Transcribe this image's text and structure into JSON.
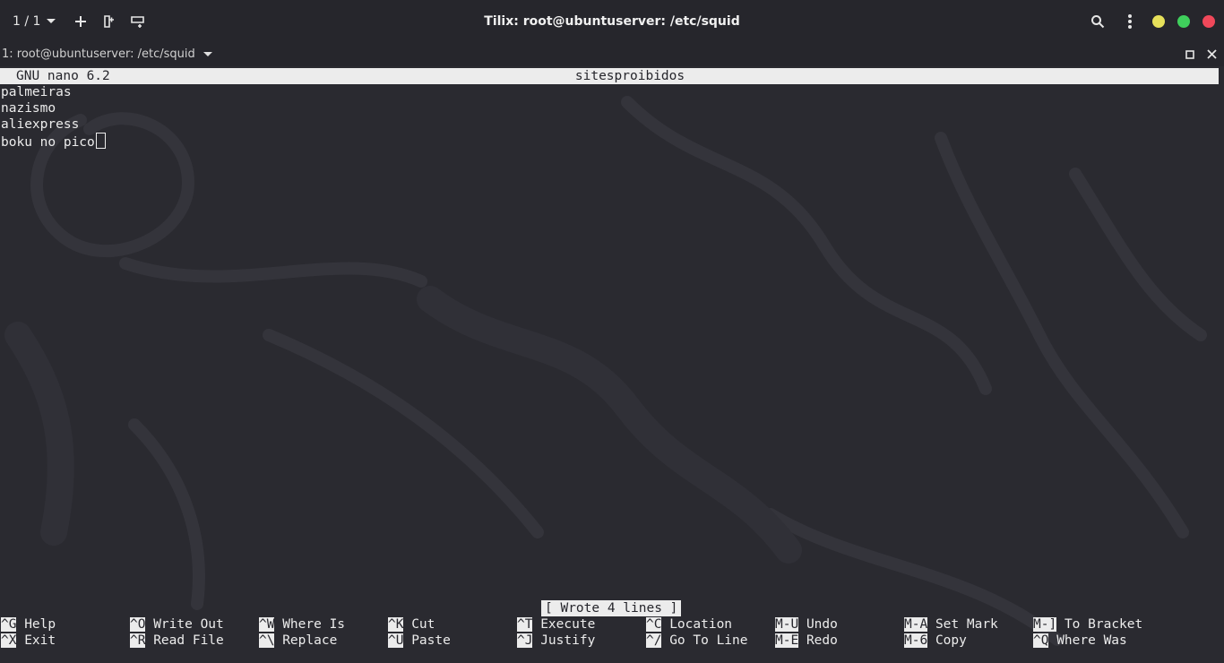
{
  "header": {
    "session_count": "1 / 1",
    "title": "Tilix: root@ubuntuserver: /etc/squid",
    "colors": {
      "minimize": "#e6e05a",
      "maximize": "#3fcf5c",
      "close": "#f0485a"
    }
  },
  "terminal_tab": {
    "title": "1: root@ubuntuserver: /etc/squid"
  },
  "nano": {
    "version": "GNU nano 6.2",
    "filename": "sitesproibidos",
    "lines": [
      "palmeiras",
      "nazismo",
      "aliexpress",
      "boku no pico"
    ],
    "status": "[ Wrote 4 lines ]",
    "shortcuts_row1": [
      {
        "key": "^G",
        "label": "Help"
      },
      {
        "key": "^O",
        "label": "Write Out"
      },
      {
        "key": "^W",
        "label": "Where Is"
      },
      {
        "key": "^K",
        "label": "Cut"
      },
      {
        "key": "^T",
        "label": "Execute"
      },
      {
        "key": "^C",
        "label": "Location"
      },
      {
        "key": "M-U",
        "label": "Undo"
      },
      {
        "key": "M-A",
        "label": "Set Mark"
      },
      {
        "key": "M-]",
        "label": "To Bracket"
      }
    ],
    "shortcuts_row2": [
      {
        "key": "^X",
        "label": "Exit"
      },
      {
        "key": "^R",
        "label": "Read File"
      },
      {
        "key": "^\\",
        "label": "Replace"
      },
      {
        "key": "^U",
        "label": "Paste"
      },
      {
        "key": "^J",
        "label": "Justify"
      },
      {
        "key": "^/",
        "label": "Go To Line"
      },
      {
        "key": "M-E",
        "label": "Redo"
      },
      {
        "key": "M-6",
        "label": "Copy"
      },
      {
        "key": "^Q",
        "label": "Where Was"
      }
    ]
  }
}
